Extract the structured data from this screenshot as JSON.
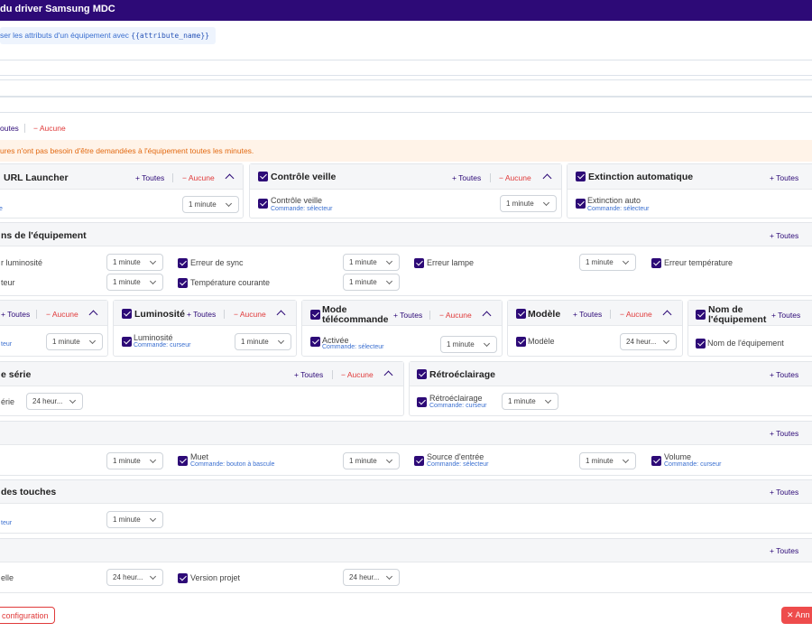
{
  "header": {
    "title": "du driver Samsung MDC"
  },
  "hint": {
    "text": "ser les attributs d'un équipement avec ",
    "code": "{{attribute_name}}"
  },
  "top_links": {
    "all": "+ Toutes",
    "all_partial": "outes",
    "none": "− Aucune"
  },
  "warning": "ures n'ont pas besoin d'être demandées à l'équipement toutes les minutes.",
  "buttons": {
    "all": "+ Toutes",
    "none": "− Aucune"
  },
  "row1": {
    "url_launcher": {
      "title": "URL Launcher",
      "sub": "e",
      "select": "1 minute"
    },
    "controle_veille": {
      "title": "Contrôle veille",
      "item": "Contrôle veille",
      "sub": "Commande: sélecteur",
      "select": "1 minute"
    },
    "extinction": {
      "title": "Extinction automatique",
      "item": "Extinction auto",
      "sub": "Commande: sélecteur"
    }
  },
  "notifications": {
    "title": "ns de l'équipement",
    "items": [
      {
        "label": "r luminosité",
        "select": "1 minute"
      },
      {
        "label": "Erreur de sync",
        "select": "1 minute"
      },
      {
        "label": "Erreur lampe",
        "select": "1 minute"
      },
      {
        "label": "Erreur température"
      },
      {
        "label": "teur",
        "select": "1 minute"
      },
      {
        "label": "Température courante",
        "select": "1 minute"
      }
    ]
  },
  "row3": {
    "c1": {
      "sub": "teur",
      "select": "1 minute"
    },
    "luminosite": {
      "title": "Luminosité",
      "item": "Luminosité",
      "sub": "Commande: curseur",
      "select": "1 minute"
    },
    "mode": {
      "title": "Mode télécommande",
      "item": "Activée",
      "sub": "Commande: sélecteur",
      "select": "1 minute"
    },
    "modele": {
      "title": "Modèle",
      "item": "Modèle",
      "select": "24 heur..."
    },
    "nom": {
      "title": "Nom de l'équipement",
      "item": "Nom de l'équipement"
    }
  },
  "row4": {
    "serie": {
      "title": "e série",
      "item": "érie",
      "select": "24 heur..."
    },
    "retro": {
      "title": "Rétroéclairage",
      "item": "Rétroéclairage",
      "sub": "Commande: curseur",
      "select": "1 minute"
    }
  },
  "row5": {
    "items": [
      {
        "select": "1 minute"
      },
      {
        "label": "Muet",
        "sub": "Commande: bouton à bascule",
        "select": "1 minute"
      },
      {
        "label": "Source d'entrée",
        "sub": "Commande: sélecteur",
        "select": "1 minute"
      },
      {
        "label": "Volume",
        "sub": "Commande: curseur"
      }
    ]
  },
  "row6": {
    "title": "des touches",
    "sub": "teur",
    "select": "1 minute"
  },
  "row7": {
    "item1": "elle",
    "select1": "24 heur...",
    "item2": "Version projet",
    "select2": "24 heur..."
  },
  "footer": {
    "left": "configuration",
    "right": "✕ Ann"
  },
  "colors": {
    "brand": "#2d0a77",
    "danger": "#e03a3a",
    "warning_bg": "#fff3e8",
    "warning_text": "#e26a12",
    "link": "#3a6fd0"
  }
}
